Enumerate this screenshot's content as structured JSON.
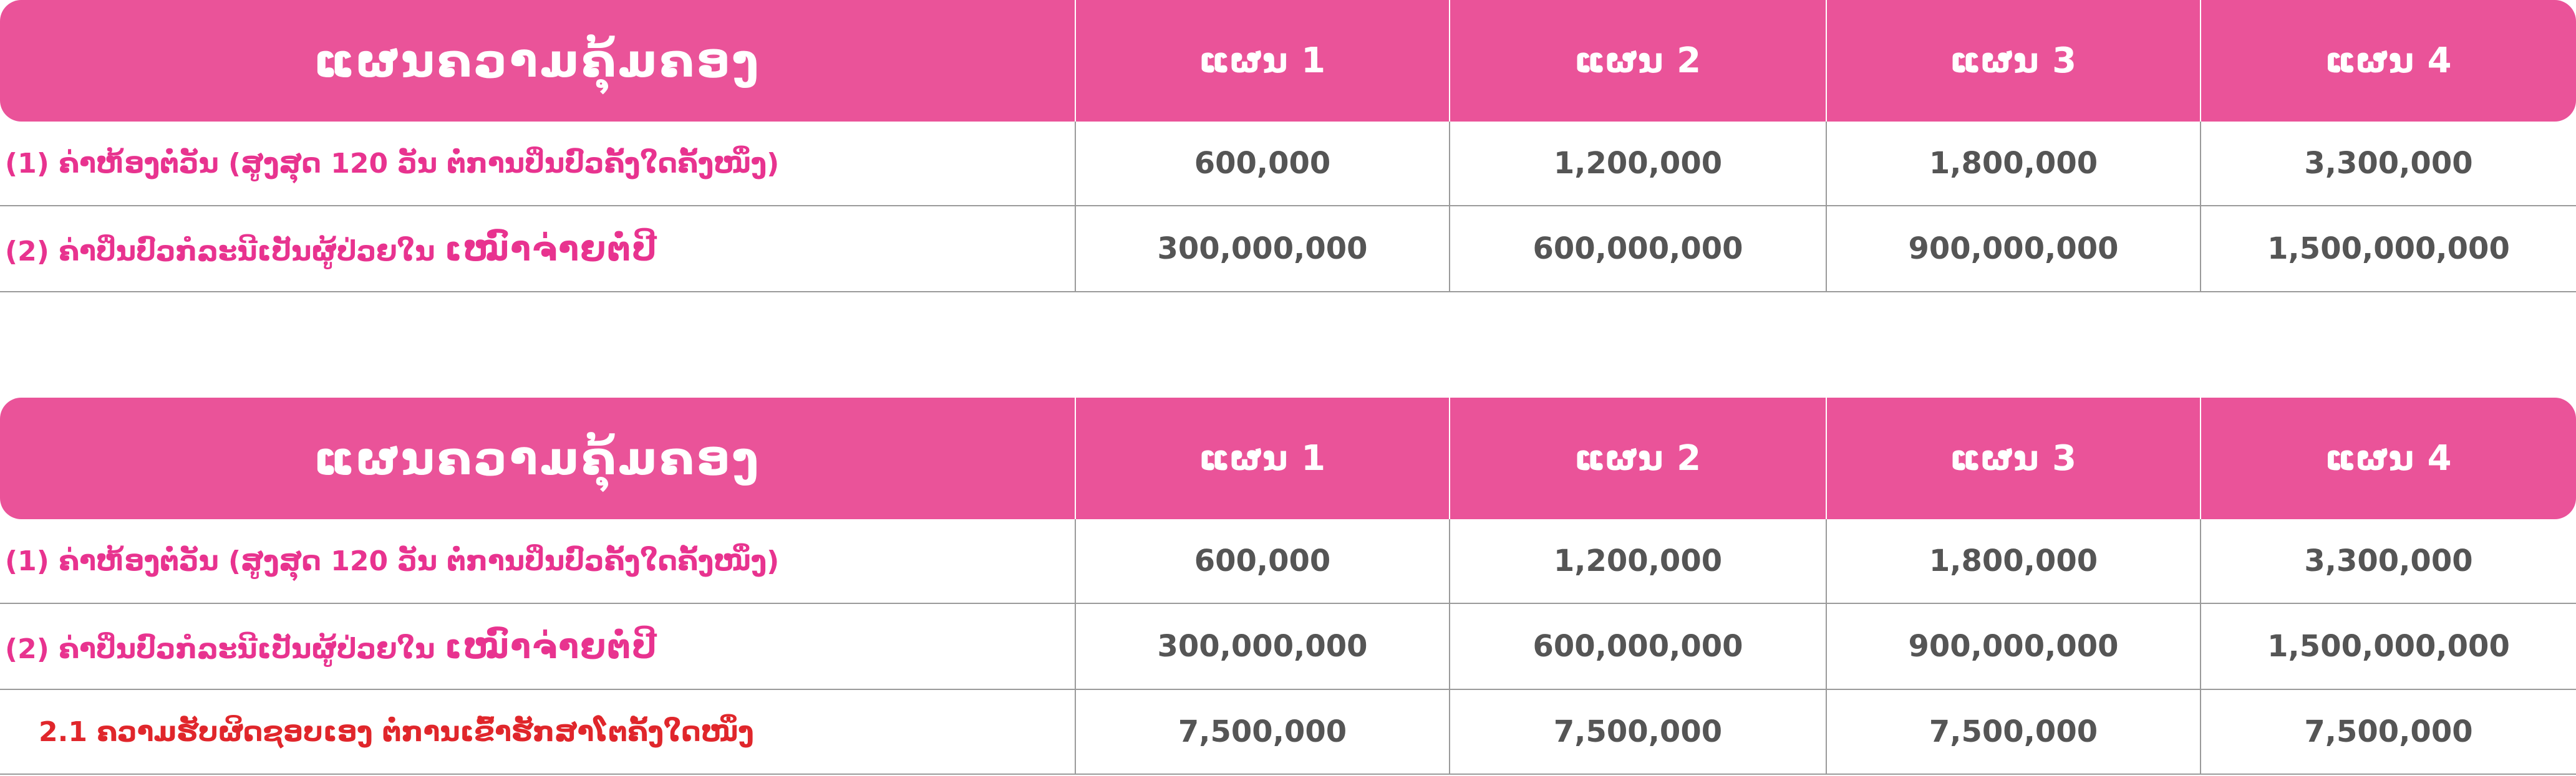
{
  "colors": {
    "header_bg": "#ea5399",
    "header_text": "#ffffff",
    "label_text": "#e8338f",
    "sub_label_text": "#e0262b",
    "value_text": "#555555",
    "grid_line": "#9a9a9a"
  },
  "tables": [
    {
      "header": {
        "title": "ແຜນຄວາມຄຸ້ມຄອງ",
        "plans": [
          "ແຜນ 1",
          "ແຜນ 2",
          "ແຜນ 3",
          "ແຜນ 4"
        ]
      },
      "rows": [
        {
          "label": "(1) ຄ່າຫ້ອງຕໍ່ວັນ (ສູງສຸດ 120 ວັນ ຕໍ່ການປິ່ນປົວຄັ້ງໃດຄັ້ງໜຶ່ງ)",
          "values": [
            "600,000",
            "1,200,000",
            "1,800,000",
            "3,300,000"
          ]
        },
        {
          "label": "(2) ຄ່າປິ່ນປົວກໍລະນີເປັນຜູ້ປ່ວຍໃນ",
          "label_emphasis": "ເໝົາຈ່າຍຕໍ່ປີ",
          "values": [
            "300,000,000",
            "600,000,000",
            "900,000,000",
            "1,500,000,000"
          ]
        }
      ]
    },
    {
      "header": {
        "title": "ແຜນຄວາມຄຸ້ມຄອງ",
        "plans": [
          "ແຜນ 1",
          "ແຜນ 2",
          "ແຜນ 3",
          "ແຜນ 4"
        ]
      },
      "rows": [
        {
          "label": "(1) ຄ່າຫ້ອງຕໍ່ວັນ (ສູງສຸດ 120 ວັນ ຕໍ່ການປິ່ນປົວຄັ້ງໃດຄັ້ງໜຶ່ງ)",
          "values": [
            "600,000",
            "1,200,000",
            "1,800,000",
            "3,300,000"
          ]
        },
        {
          "label": "(2) ຄ່າປິ່ນປົວກໍລະນີເປັນຜູ້ປ່ວຍໃນ",
          "label_emphasis": "ເໝົາຈ່າຍຕໍ່ປີ",
          "values": [
            "300,000,000",
            "600,000,000",
            "900,000,000",
            "1,500,000,000"
          ]
        },
        {
          "label": "2.1 ຄວາມຮັບຜິດຊອບເອງ ຕໍ່ການເຂົ້າຮັກສາໂຕຄັ້ງໃດໜຶ່ງ",
          "values": [
            "7,500,000",
            "7,500,000",
            "7,500,000",
            "7,500,000"
          ]
        }
      ]
    }
  ]
}
